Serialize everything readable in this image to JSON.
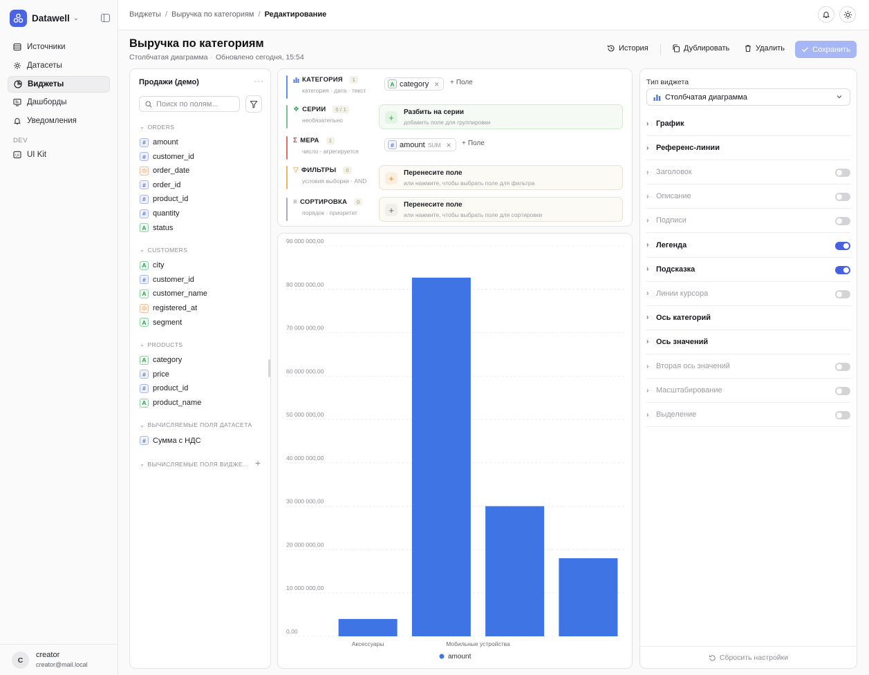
{
  "sidebar": {
    "brand": "Datawell",
    "items": [
      {
        "label": "Источники",
        "icon": "database-icon"
      },
      {
        "label": "Датасеты",
        "icon": "dataset-icon"
      },
      {
        "label": "Виджеты",
        "icon": "widget-icon"
      },
      {
        "label": "Дашборды",
        "icon": "dashboard-icon"
      },
      {
        "label": "Уведомления",
        "icon": "bell-icon"
      }
    ],
    "section_dev": "DEV",
    "ui_kit": "UI Kit",
    "user": {
      "initial": "C",
      "name": "creator",
      "email": "creator@mail.local"
    }
  },
  "breadcrumb": {
    "a": "Виджеты",
    "b": "Выручка по категориям",
    "c": "Редактирование",
    "sep": "/"
  },
  "header": {
    "title": "Выручка по категориям",
    "subtitle_type": "Столбчатая диаграмма",
    "subtitle_updated": "Обновлено сегодня, 15:54",
    "history": "История",
    "duplicate": "Дублировать",
    "delete": "Удалить",
    "save": "Сохранить"
  },
  "fields_panel": {
    "title": "Продажи (демо)",
    "more": "···",
    "search_placeholder": "Поиск по полям...",
    "groups": [
      {
        "name": "ORDERS",
        "fields": [
          {
            "t": "#",
            "n": "amount"
          },
          {
            "t": "#",
            "n": "customer_id"
          },
          {
            "t": "d",
            "n": "order_date"
          },
          {
            "t": "#",
            "n": "order_id"
          },
          {
            "t": "#",
            "n": "product_id"
          },
          {
            "t": "#",
            "n": "quantity"
          },
          {
            "t": "A",
            "n": "status"
          }
        ]
      },
      {
        "name": "CUSTOMERS",
        "fields": [
          {
            "t": "A",
            "n": "city"
          },
          {
            "t": "#",
            "n": "customer_id"
          },
          {
            "t": "A",
            "n": "customer_name"
          },
          {
            "t": "d",
            "n": "registered_at"
          },
          {
            "t": "A",
            "n": "segment"
          }
        ]
      },
      {
        "name": "PRODUCTS",
        "fields": [
          {
            "t": "A",
            "n": "category"
          },
          {
            "t": "#",
            "n": "price"
          },
          {
            "t": "#",
            "n": "product_id"
          },
          {
            "t": "A",
            "n": "product_name"
          }
        ]
      },
      {
        "name": "ВЫЧИСЛЯЕМЫЕ ПОЛЯ ДАТАСЕТА",
        "fields": [
          {
            "t": "#",
            "n": "Сумма с НДС"
          }
        ]
      }
    ],
    "widget_calc_group": "ВЫЧИСЛЯЕМЫЕ ПОЛЯ ВИДЖЕ..."
  },
  "slots": {
    "category": {
      "name": "КАТЕГОРИЯ",
      "count": "1",
      "hint": "категория · дата · текст",
      "chip": "category",
      "chip_type": "A",
      "add": "Поле"
    },
    "series": {
      "name": "СЕРИИ",
      "count": "0 / 1",
      "hint": "необязательно",
      "dz_title": "Разбить на серии",
      "dz_hint": "добавить поле для группировки"
    },
    "measure": {
      "name": "МЕРА",
      "count": "1",
      "hint": "число · агрегируется",
      "chip": "amount",
      "chip_type": "#",
      "agg": "SUM",
      "add": "Поле"
    },
    "filters": {
      "name": "ФИЛЬТРЫ",
      "count": "0",
      "hint": "условия выборки · AND",
      "dz_title": "Перенесите поле",
      "dz_hint": "или нажмите, чтобы выбрать поле для фильтра"
    },
    "sort": {
      "name": "СОРТИРОВКА",
      "count": "0",
      "hint": "порядок · приоритет",
      "dz_title": "Перенесите поле",
      "dz_hint": "или нажмите, чтобы выбрать поле для сортировки"
    }
  },
  "chart_data": {
    "type": "bar",
    "categories": [
      "Аксессуары",
      "",
      "Мобильные устройства",
      ""
    ],
    "series": [
      {
        "name": "amount",
        "values": [
          4000000,
          82700000,
          30000000,
          18000000
        ]
      }
    ],
    "ylim": [
      0,
      90000000
    ],
    "yticks": [
      "0,00",
      "10 000 000,00",
      "20 000 000,00",
      "30 000 000,00",
      "40 000 000,00",
      "50 000 000,00",
      "60 000 000,00",
      "70 000 000,00",
      "80 000 000,00",
      "90 000 000,00"
    ],
    "grid": true,
    "legend": "bottom",
    "color": "#3f74e4"
  },
  "settings": {
    "type_label": "Тип виджета",
    "type_value": "Столбчатая диаграмма",
    "rows": [
      {
        "label": "График",
        "toggle": null,
        "enabled": true
      },
      {
        "label": "Референс-линии",
        "toggle": null,
        "enabled": true
      },
      {
        "label": "Заголовок",
        "toggle": false,
        "enabled": false
      },
      {
        "label": "Описание",
        "toggle": false,
        "enabled": false
      },
      {
        "label": "Подписи",
        "toggle": false,
        "enabled": false
      },
      {
        "label": "Легенда",
        "toggle": true,
        "enabled": true
      },
      {
        "label": "Подсказка",
        "toggle": true,
        "enabled": true
      },
      {
        "label": "Линии курсора",
        "toggle": false,
        "enabled": false
      },
      {
        "label": "Ось категорий",
        "toggle": null,
        "enabled": true
      },
      {
        "label": "Ось значений",
        "toggle": null,
        "enabled": true
      },
      {
        "label": "Вторая ось значений",
        "toggle": false,
        "enabled": false
      },
      {
        "label": "Масштабирование",
        "toggle": false,
        "enabled": false
      },
      {
        "label": "Выделение",
        "toggle": false,
        "enabled": false
      }
    ],
    "reset": "Сбросить настройки"
  }
}
